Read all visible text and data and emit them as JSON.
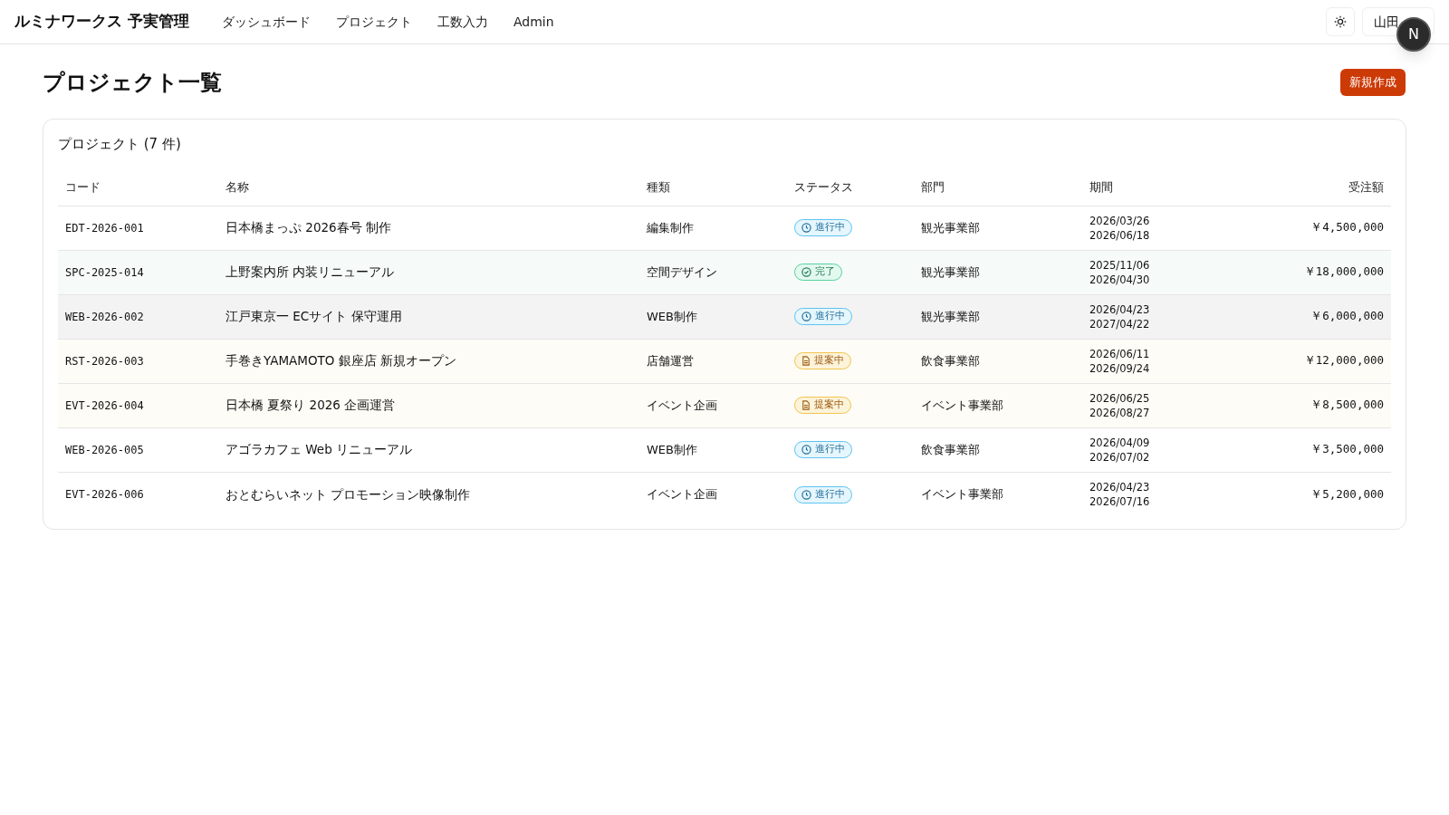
{
  "header": {
    "brand": "ルミナワークス 予実管理",
    "nav": [
      {
        "label": "ダッシュボード"
      },
      {
        "label": "プロジェクト"
      },
      {
        "label": "工数入力"
      },
      {
        "label": "Admin"
      }
    ],
    "user": "山田",
    "dev_badge": "N"
  },
  "page": {
    "title": "プロジェクト一覧",
    "new_button": "新規作成"
  },
  "card": {
    "title": "プロジェクト (7 件)",
    "table": {
      "columns": [
        "コード",
        "名称",
        "種類",
        "ステータス",
        "部門",
        "期間",
        "受注額"
      ],
      "rows": [
        {
          "code": "EDT-2026-001",
          "name": "日本橋まっぷ 2026春号 制作",
          "type": "編集制作",
          "status": {
            "kind": "progress",
            "label": "進行中"
          },
          "dept": "観光事業部",
          "start": "2026/03/26",
          "end": "2026/06/18",
          "amount": "￥4,500,000",
          "hovered": false
        },
        {
          "code": "SPC-2025-014",
          "name": "上野案内所 内装リニューアル",
          "type": "空間デザイン",
          "status": {
            "kind": "done",
            "label": "完了"
          },
          "dept": "観光事業部",
          "start": "2025/11/06",
          "end": "2026/04/30",
          "amount": "￥18,000,000",
          "hovered": false
        },
        {
          "code": "WEB-2026-002",
          "name": "江戸東京一 ECサイト 保守運用",
          "type": "WEB制作",
          "status": {
            "kind": "progress",
            "label": "進行中"
          },
          "dept": "観光事業部",
          "start": "2026/04/23",
          "end": "2027/04/22",
          "amount": "￥6,000,000",
          "hovered": true
        },
        {
          "code": "RST-2026-003",
          "name": "手巻きYAMAMOTO 銀座店 新規オープン",
          "type": "店舗運営",
          "status": {
            "kind": "proposal",
            "label": "提案中"
          },
          "dept": "飲食事業部",
          "start": "2026/06/11",
          "end": "2026/09/24",
          "amount": "￥12,000,000",
          "hovered": false
        },
        {
          "code": "EVT-2026-004",
          "name": "日本橋 夏祭り 2026 企画運営",
          "type": "イベント企画",
          "status": {
            "kind": "proposal",
            "label": "提案中"
          },
          "dept": "イベント事業部",
          "start": "2026/06/25",
          "end": "2026/08/27",
          "amount": "￥8,500,000",
          "hovered": false
        },
        {
          "code": "WEB-2026-005",
          "name": "アゴラカフェ Web リニューアル",
          "type": "WEB制作",
          "status": {
            "kind": "progress",
            "label": "進行中"
          },
          "dept": "飲食事業部",
          "start": "2026/04/09",
          "end": "2026/07/02",
          "amount": "￥3,500,000",
          "hovered": false
        },
        {
          "code": "EVT-2026-006",
          "name": "おとむらいネット プロモーション映像制作",
          "type": "イベント企画",
          "status": {
            "kind": "progress",
            "label": "進行中"
          },
          "dept": "イベント事業部",
          "start": "2026/04/23",
          "end": "2026/07/16",
          "amount": "￥5,200,000",
          "hovered": false
        }
      ]
    }
  }
}
